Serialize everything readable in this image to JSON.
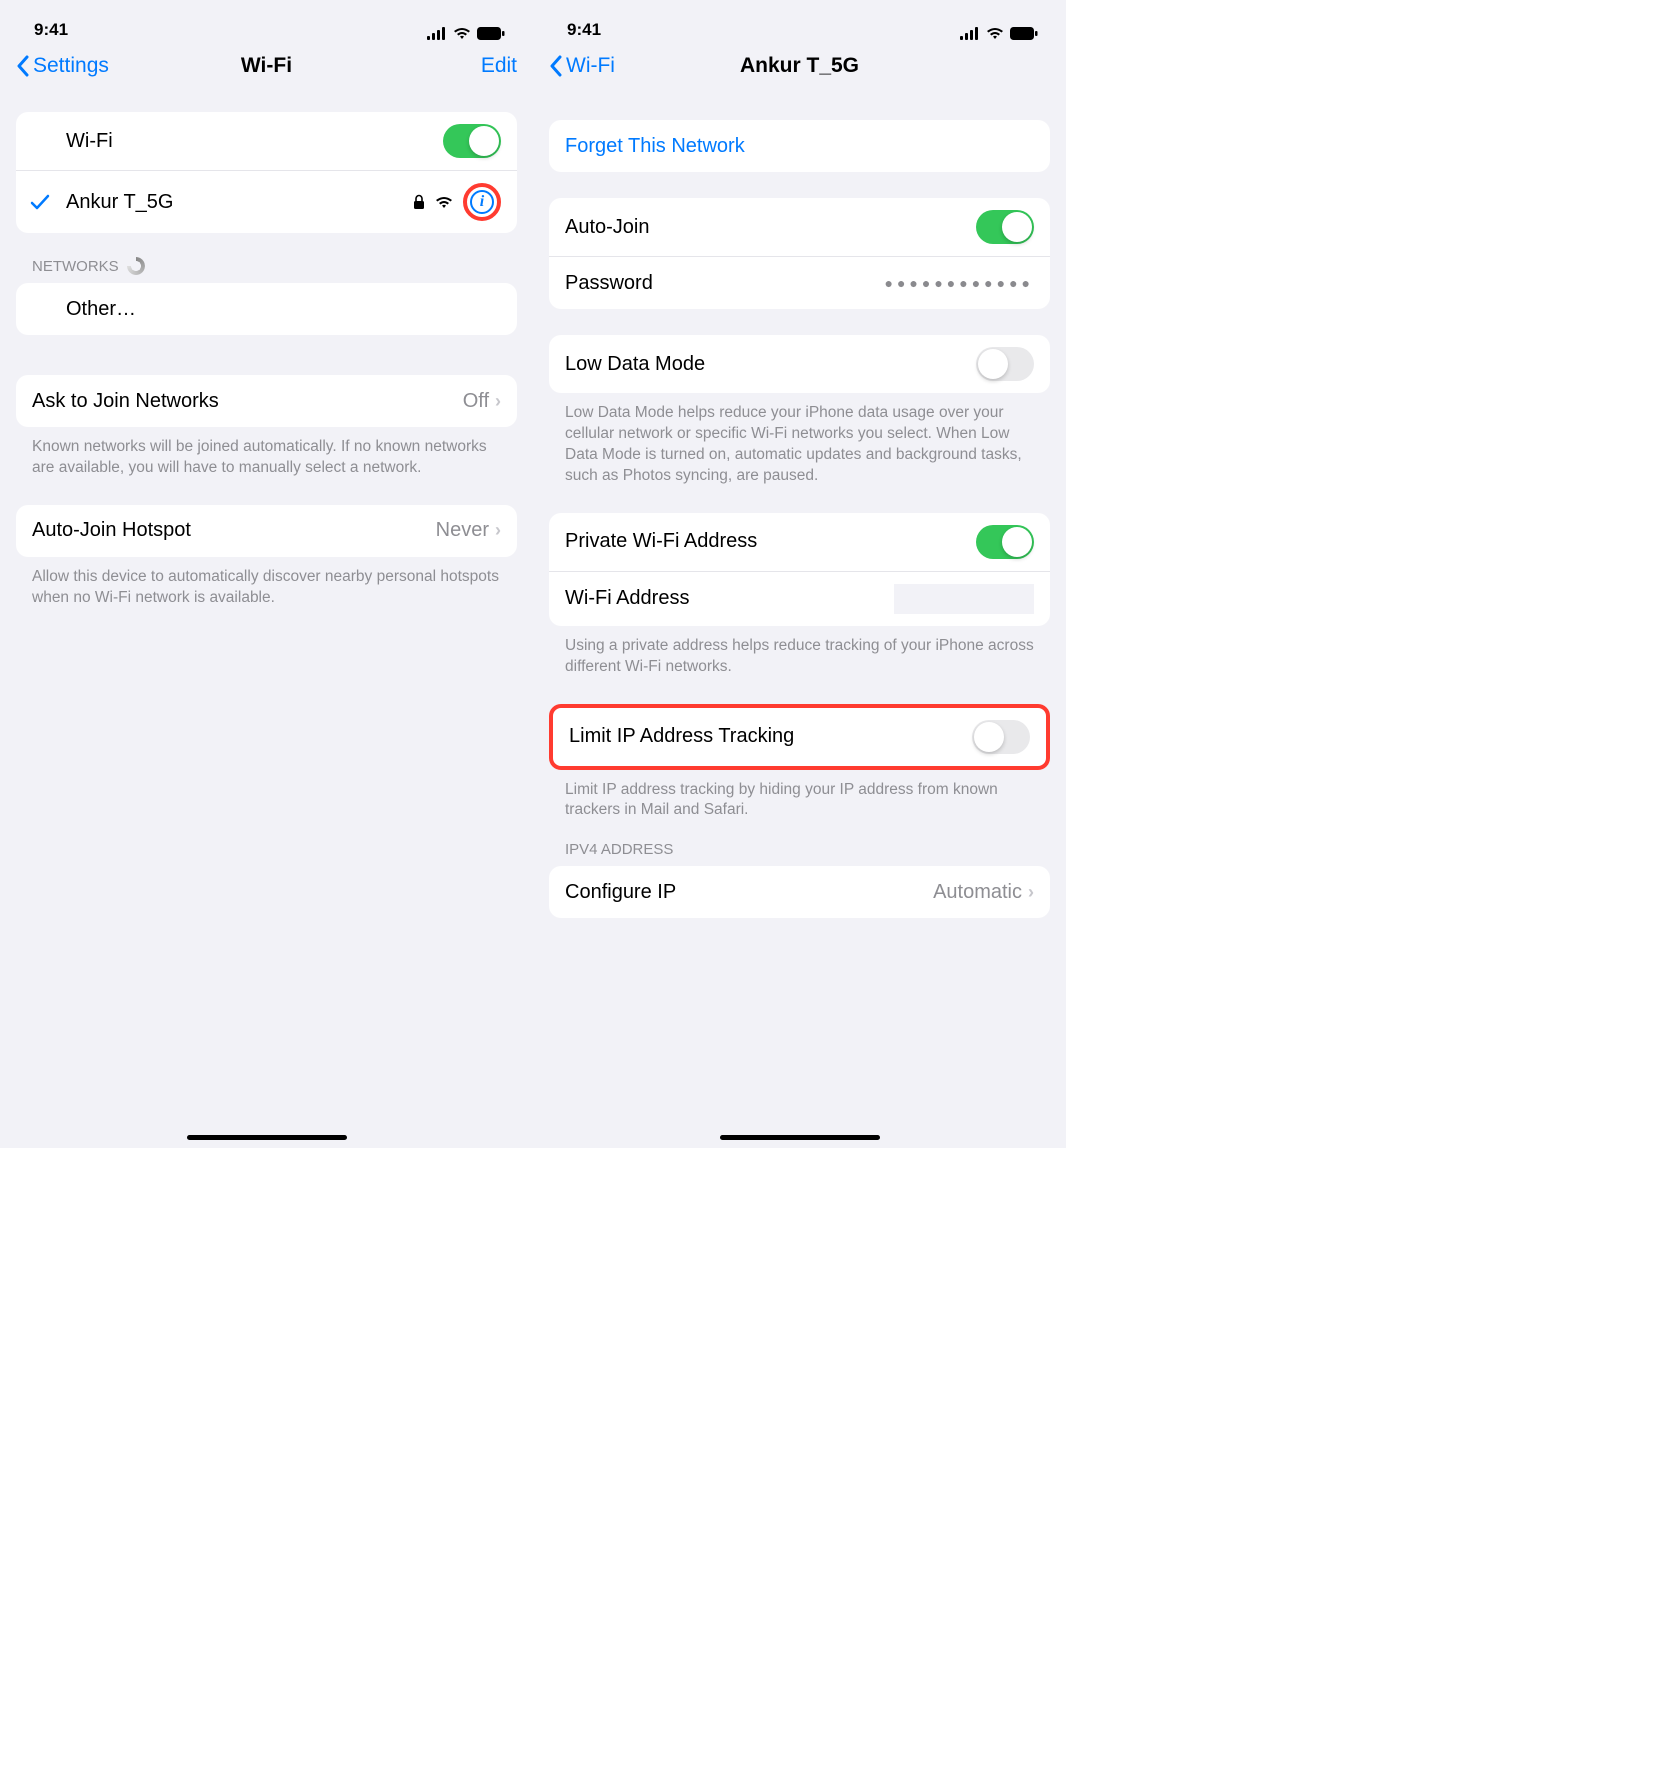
{
  "status": {
    "time": "9:41"
  },
  "left": {
    "nav": {
      "back": "Settings",
      "title": "Wi-Fi",
      "edit": "Edit"
    },
    "wifi_row": "Wi-Fi",
    "connected_network": "Ankur T_5G",
    "networks_header": "NETWORKS",
    "other": "Other…",
    "ask_join": {
      "label": "Ask to Join Networks",
      "value": "Off"
    },
    "ask_footer": "Known networks will be joined automatically. If no known networks are available, you will have to manually select a network.",
    "hotspot": {
      "label": "Auto-Join Hotspot",
      "value": "Never"
    },
    "hotspot_footer": "Allow this device to automatically discover nearby personal hotspots when no Wi-Fi network is available."
  },
  "right": {
    "nav": {
      "back": "Wi-Fi",
      "title": "Ankur T_5G"
    },
    "forget": "Forget This Network",
    "auto_join": "Auto-Join",
    "password": "Password",
    "password_dots": "●●●●●●●●●●●●",
    "low_data": "Low Data Mode",
    "low_data_footer": "Low Data Mode helps reduce your iPhone data usage over your cellular network or specific Wi-Fi networks you select. When Low Data Mode is turned on, automatic updates and background tasks, such as Photos syncing, are paused.",
    "private_addr": "Private Wi-Fi Address",
    "wifi_addr": "Wi-Fi Address",
    "private_footer": "Using a private address helps reduce tracking of your iPhone across different Wi-Fi networks.",
    "limit_ip": "Limit IP Address Tracking",
    "limit_ip_footer": "Limit IP address tracking by hiding your IP address from known trackers in Mail and Safari.",
    "ipv4_header": "IPV4 ADDRESS",
    "configure_ip": {
      "label": "Configure IP",
      "value": "Automatic"
    }
  }
}
